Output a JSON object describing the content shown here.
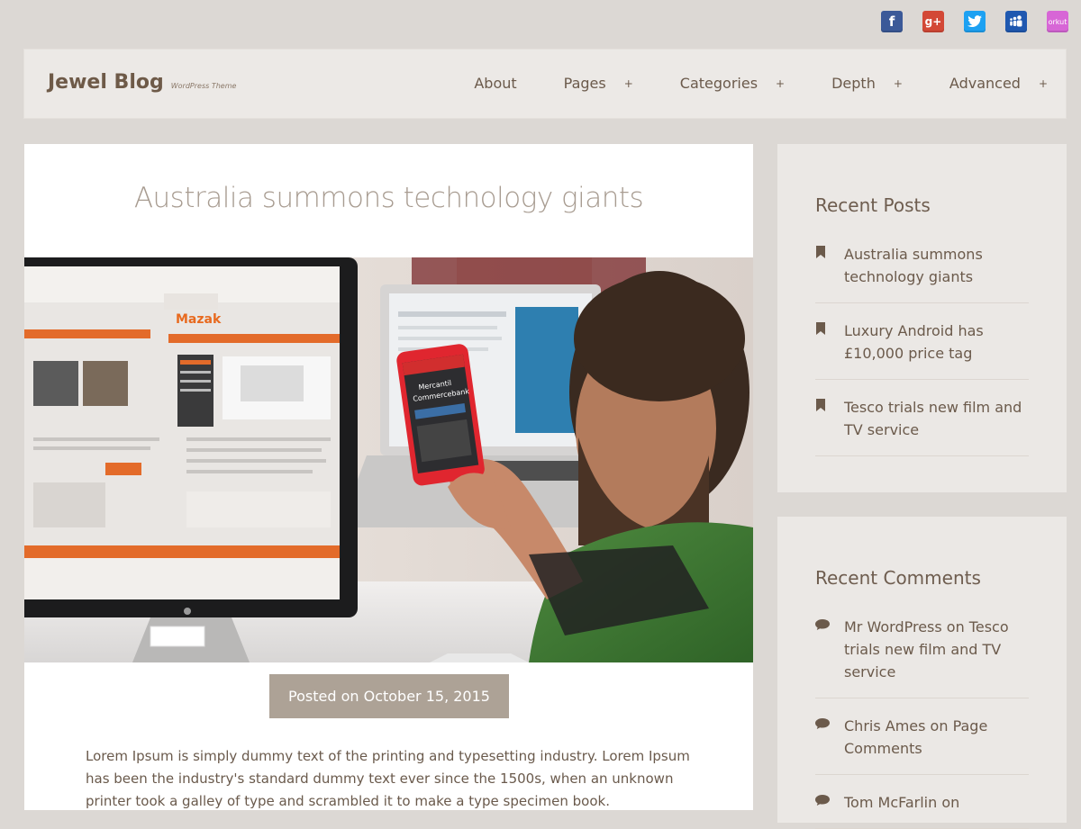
{
  "social": {
    "icons": [
      {
        "name": "facebook-icon",
        "glyph": "f"
      },
      {
        "name": "google-plus-icon",
        "glyph": "g+"
      },
      {
        "name": "twitter-icon",
        "glyph": "t"
      },
      {
        "name": "myspace-icon",
        "glyph": "m"
      },
      {
        "name": "orkut-icon",
        "glyph": "orkut"
      }
    ]
  },
  "header": {
    "title": "Jewel Blog",
    "tagline": "WordPress Theme",
    "nav": [
      {
        "label": "About",
        "plus": ""
      },
      {
        "label": "Pages",
        "plus": "+"
      },
      {
        "label": "Categories",
        "plus": "+"
      },
      {
        "label": "Depth",
        "plus": "+"
      },
      {
        "label": "Advanced",
        "plus": "+"
      }
    ]
  },
  "article": {
    "title": "Australia summons technology giants",
    "posted": "Posted on October 15, 2015",
    "body": "Lorem Ipsum is simply dummy text of the printing and typesetting industry. Lorem Ipsum has been the industry's standard dummy text ever since the 1500s, when an unknown printer took a galley of type and scrambled it to make a type specimen book.",
    "image": {
      "site_logo": "Mazak",
      "phone_text_1": "Mercantil",
      "phone_text_2": "Commercebank"
    }
  },
  "sidebar": {
    "recent_posts": {
      "title": "Recent Posts",
      "items": [
        "Australia summons technology giants",
        "Luxury Android has £10,000 price tag",
        "Tesco trials new film and TV service"
      ]
    },
    "recent_comments": {
      "title": "Recent Comments",
      "items": [
        "Mr WordPress on Tesco trials new film and TV service",
        "Chris Ames on Page Comments",
        "Tom McFarlin on"
      ]
    }
  },
  "colors": {
    "background": "#dcd8d4",
    "header_bg": "#ece9e6",
    "widget_bg": "#ebe8e5",
    "posted_bg": "#ada296",
    "text": "#6b5a4b"
  }
}
